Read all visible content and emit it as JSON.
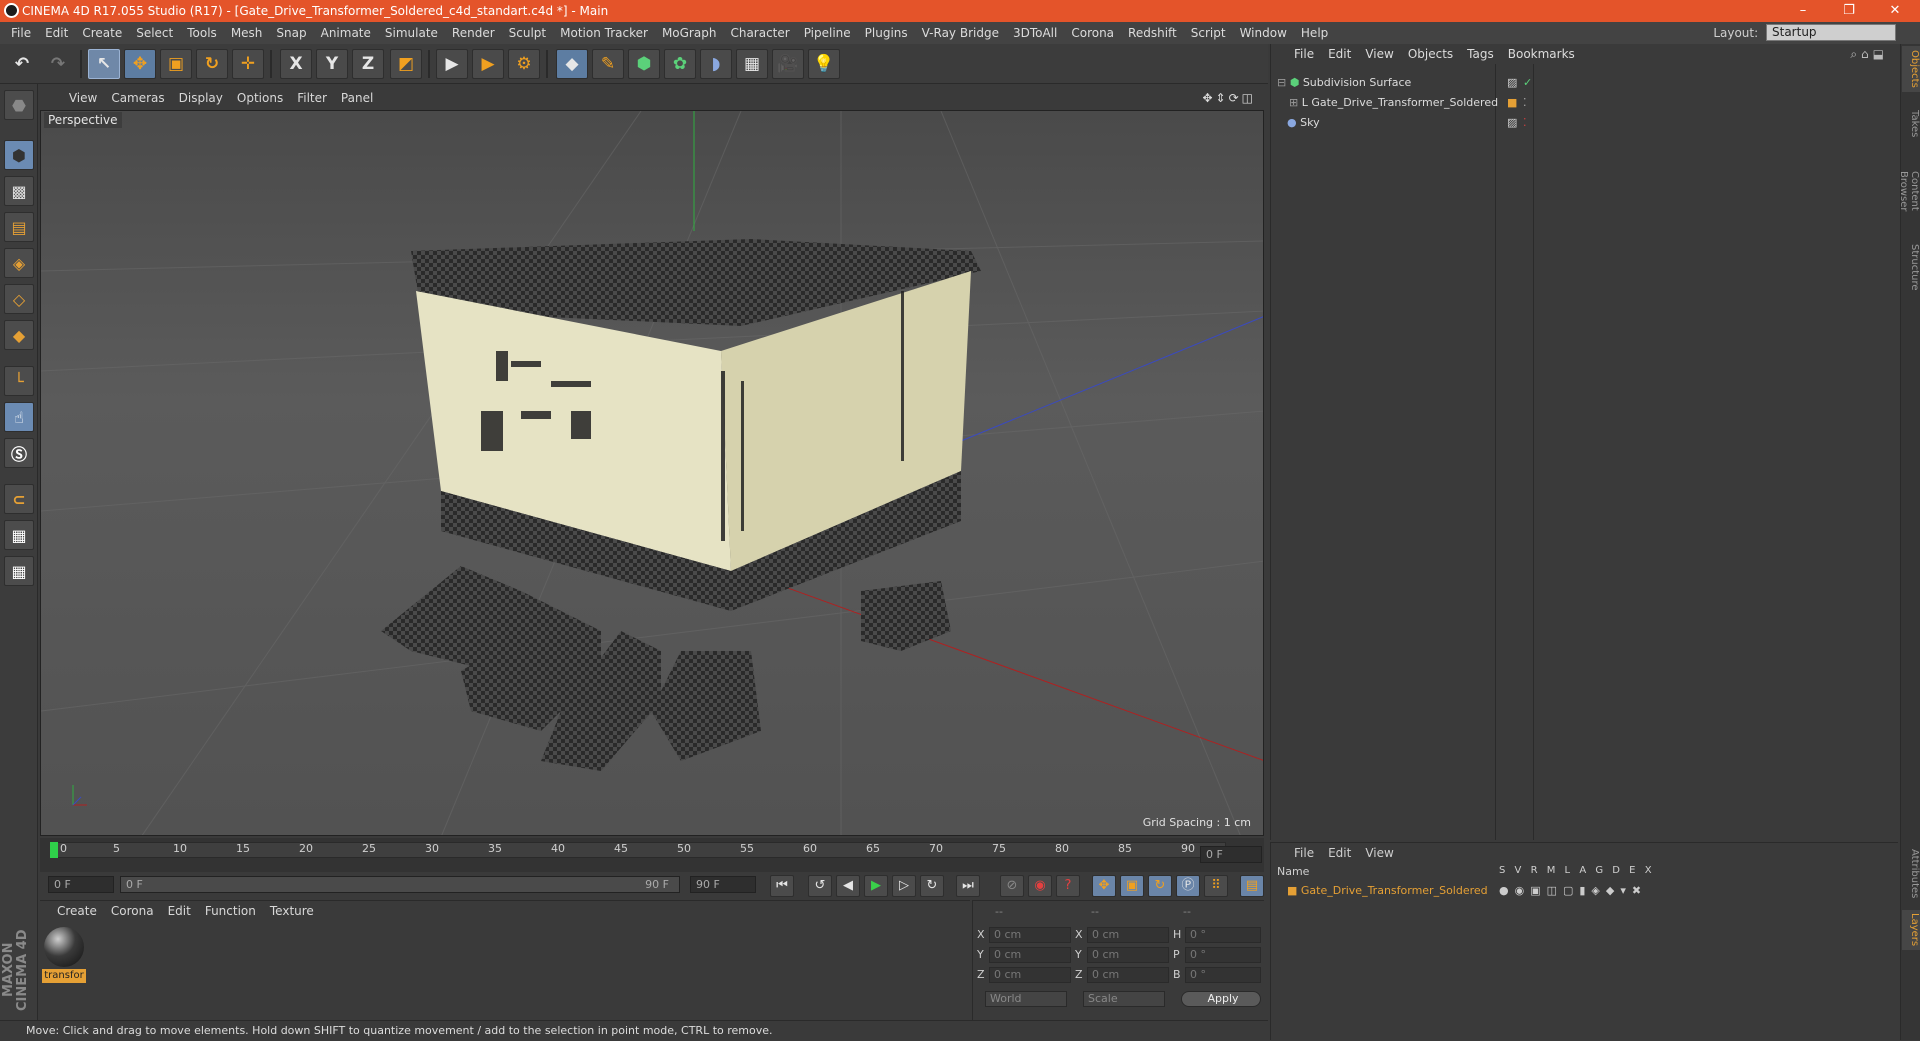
{
  "window": {
    "title": "CINEMA 4D R17.055 Studio (R17) - [Gate_Drive_Transformer_Soldered_c4d_standart.c4d *] - Main",
    "minimize_glyph": "–",
    "maximize_glyph": "❐",
    "close_glyph": "✕"
  },
  "menubar": {
    "items": [
      "File",
      "Edit",
      "Create",
      "Select",
      "Tools",
      "Mesh",
      "Snap",
      "Animate",
      "Simulate",
      "Render",
      "Sculpt",
      "Motion Tracker",
      "MoGraph",
      "Character",
      "Pipeline",
      "Plugins",
      "V-Ray Bridge",
      "3DToAll",
      "Corona",
      "Redshift",
      "Script",
      "Window",
      "Help"
    ],
    "layout_label": "Layout:",
    "layout_value": "Startup"
  },
  "toolbar": {
    "x_label": "X",
    "y_label": "Y",
    "z_label": "Z"
  },
  "viewport": {
    "menu": [
      "View",
      "Cameras",
      "Display",
      "Options",
      "Filter",
      "Panel"
    ],
    "label": "Perspective",
    "grid_spacing": "Grid Spacing : 1 cm"
  },
  "timeline": {
    "ticks": [
      "0",
      "5",
      "10",
      "15",
      "20",
      "25",
      "30",
      "35",
      "40",
      "45",
      "50",
      "55",
      "60",
      "65",
      "70",
      "75",
      "80",
      "85",
      "90"
    ],
    "current_frame": "0 F",
    "start_field": "0 F",
    "range_start": "0 F",
    "range_end": "90 F",
    "end_field": "90 F"
  },
  "material_manager": {
    "menu": [
      "Create",
      "Corona",
      "Edit",
      "Function",
      "Texture"
    ],
    "material_name": "transfor"
  },
  "coordinates": {
    "headers": [
      "--",
      "--",
      "--"
    ],
    "rows": [
      {
        "a": "X",
        "av": "0 cm",
        "b": "X",
        "bv": "0 cm",
        "c": "H",
        "cv": "0 °"
      },
      {
        "a": "Y",
        "av": "0 cm",
        "b": "Y",
        "bv": "0 cm",
        "c": "P",
        "cv": "0 °"
      },
      {
        "a": "Z",
        "av": "0 cm",
        "b": "Z",
        "bv": "0 cm",
        "c": "B",
        "cv": "0 °"
      }
    ],
    "world": "World",
    "scale": "Scale",
    "apply": "Apply"
  },
  "status": {
    "text": "Move: Click and drag to move elements. Hold down SHIFT to quantize movement / add to the selection in point mode, CTRL to remove."
  },
  "branding": {
    "text": "MAXON CINEMA 4D"
  },
  "object_manager": {
    "menu": [
      "File",
      "Edit",
      "View",
      "Objects",
      "Tags",
      "Bookmarks"
    ],
    "objects": [
      {
        "name": "Subdivision Surface"
      },
      {
        "name": "Gate_Drive_Transformer_Soldered"
      },
      {
        "name": "Sky"
      }
    ]
  },
  "layer_manager": {
    "menu": [
      "File",
      "Edit",
      "View"
    ],
    "col_name": "Name",
    "cols": [
      "S",
      "V",
      "R",
      "M",
      "L",
      "A",
      "G",
      "D",
      "E",
      "X"
    ],
    "layer_name": "Gate_Drive_Transformer_Soldered",
    "layer_color": "#e5a035"
  },
  "right_tabs": [
    "Objects",
    "Takes",
    "Content Browser",
    "Structure",
    "Attributes",
    "Layers"
  ],
  "colors": {
    "title_bar": "#e4542a",
    "accent": "#e5a035",
    "selection_blue": "#6b8bb3"
  }
}
